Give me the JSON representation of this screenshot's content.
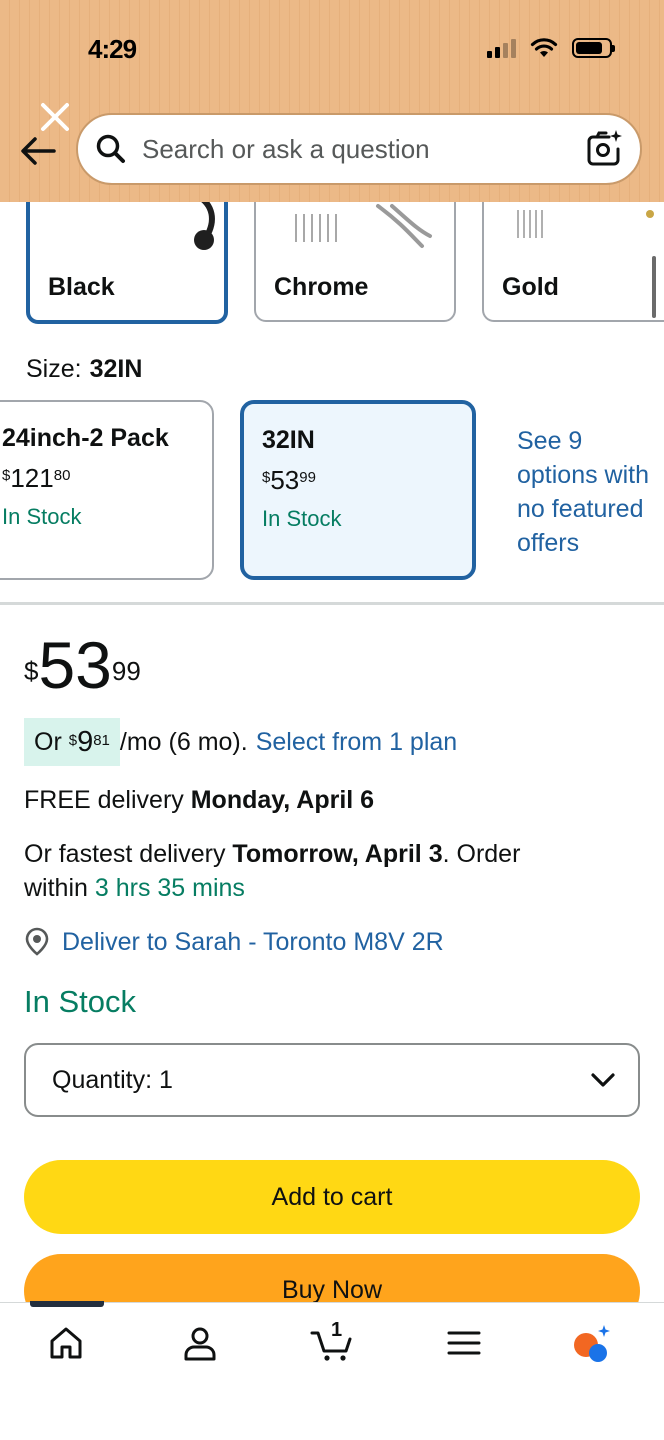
{
  "status_bar": {
    "time": "4:29"
  },
  "search": {
    "placeholder": "Search or ask a question"
  },
  "colors": [
    {
      "label": "Black",
      "selected": true
    },
    {
      "label": "Chrome",
      "selected": false
    },
    {
      "label": "Gold",
      "selected": false
    }
  ],
  "size": {
    "label": "Size:",
    "value": "32IN"
  },
  "size_options": [
    {
      "title": "24inch-2 Pack",
      "currency": "$",
      "whole": "121",
      "fraction": "80",
      "stock": "In Stock",
      "selected": false
    },
    {
      "title": "32IN",
      "currency": "$",
      "whole": "53",
      "fraction": "99",
      "stock": "In Stock",
      "selected": true
    }
  ],
  "see_options": [
    "See 9",
    "options with",
    "no featured",
    "offers"
  ],
  "price": {
    "currency": "$",
    "whole": "53",
    "fraction": "99"
  },
  "monthly": {
    "prefix": "Or",
    "currency": "$",
    "whole": "9",
    "fraction": "81",
    "suffix": "/mo (6 mo).",
    "link": "Select from 1 plan"
  },
  "delivery": {
    "free_prefix": "FREE delivery",
    "free_date": "Monday, April 6"
  },
  "fastest": {
    "prefix": "Or fastest delivery",
    "date": "Tomorrow, April 3",
    "mid": ". Order",
    "within": "within",
    "countdown": "3 hrs 35 mins"
  },
  "location": {
    "text": "Deliver to Sarah - Toronto M8V 2R"
  },
  "stock": "In Stock",
  "quantity": {
    "label": "Quantity:",
    "value": "1"
  },
  "buttons": {
    "add_to_cart": "Add to cart",
    "buy_now": "Buy Now"
  },
  "nav": {
    "cart_count": "1"
  },
  "theme": {
    "accent_blue": "#2162a1",
    "stock_green": "#067d62",
    "cart_yellow": "#ffd814",
    "buy_orange": "#ffa41c",
    "header": "#ecb987"
  }
}
